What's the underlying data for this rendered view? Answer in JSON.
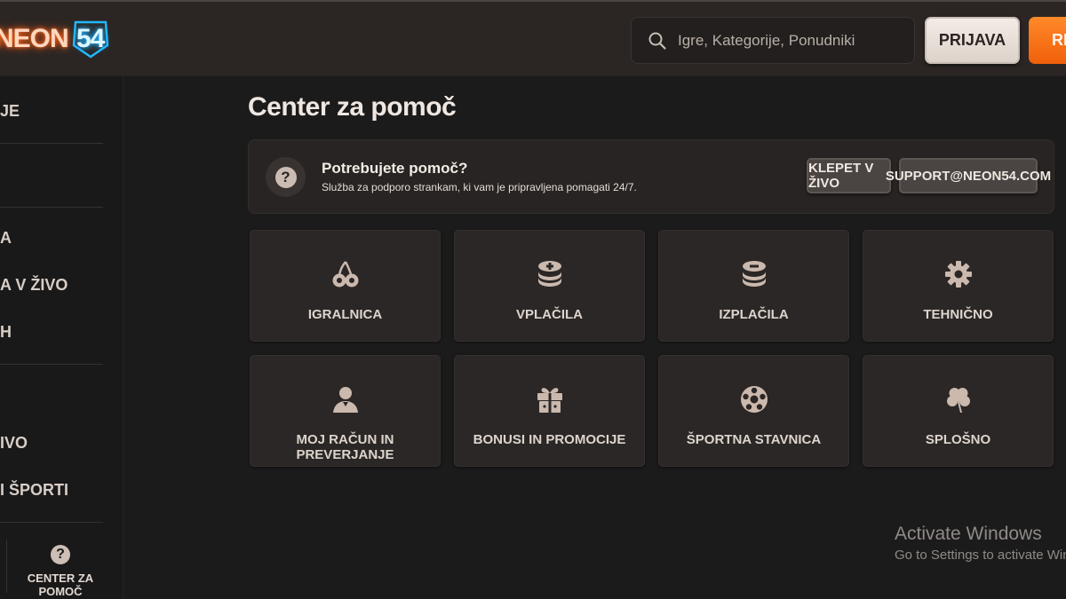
{
  "header": {
    "logo_text": "NEON",
    "logo_number": "54",
    "search_placeholder": "Igre, Kategorije, Ponudniki",
    "login_label": "PRIJAVA",
    "register_label": "RE"
  },
  "sidebar": {
    "items": [
      "JE",
      "A",
      "A V ŽIVO",
      "H",
      "IVO",
      "I ŠPORTI"
    ],
    "help_label": "CENTER ZA POMOČ"
  },
  "main": {
    "title": "Center za pomoč",
    "help_box": {
      "heading": "Potrebujete pomoč?",
      "text": "Služba za podporo strankam, ki vam je pripravljena pomagati 24/7.",
      "live_chat_label": "KLEPET V ŽIVO",
      "email_label": "SUPPORT@NEON54.COM"
    },
    "categories": [
      {
        "label": "IGRALNICA",
        "icon": "cherries-icon"
      },
      {
        "label": "VPLAČILA",
        "icon": "coins-plus-icon"
      },
      {
        "label": "IZPLAČILA",
        "icon": "coins-minus-icon"
      },
      {
        "label": "TEHNIČNO",
        "icon": "gear-icon"
      },
      {
        "label": "MOJ RAČUN IN PREVERJANJE",
        "icon": "user-icon"
      },
      {
        "label": "BONUSI IN PROMOCIJE",
        "icon": "gift-icon"
      },
      {
        "label": "ŠPORTNA STAVNICA",
        "icon": "soccer-ball-icon"
      },
      {
        "label": "SPLOŠNO",
        "icon": "clover-icon"
      }
    ]
  },
  "overlay": {
    "line1": "Activate Windows",
    "line2": "Go to Settings to activate Windows."
  },
  "colors": {
    "background": "#1c1b1b",
    "topbar": "#2b2624",
    "tile": "#2b2726",
    "icon": "#cbb9ae",
    "accent_orange": "#f05f0a",
    "neon_orange": "#ff6a1f",
    "neon_blue": "#1aa7ff"
  }
}
